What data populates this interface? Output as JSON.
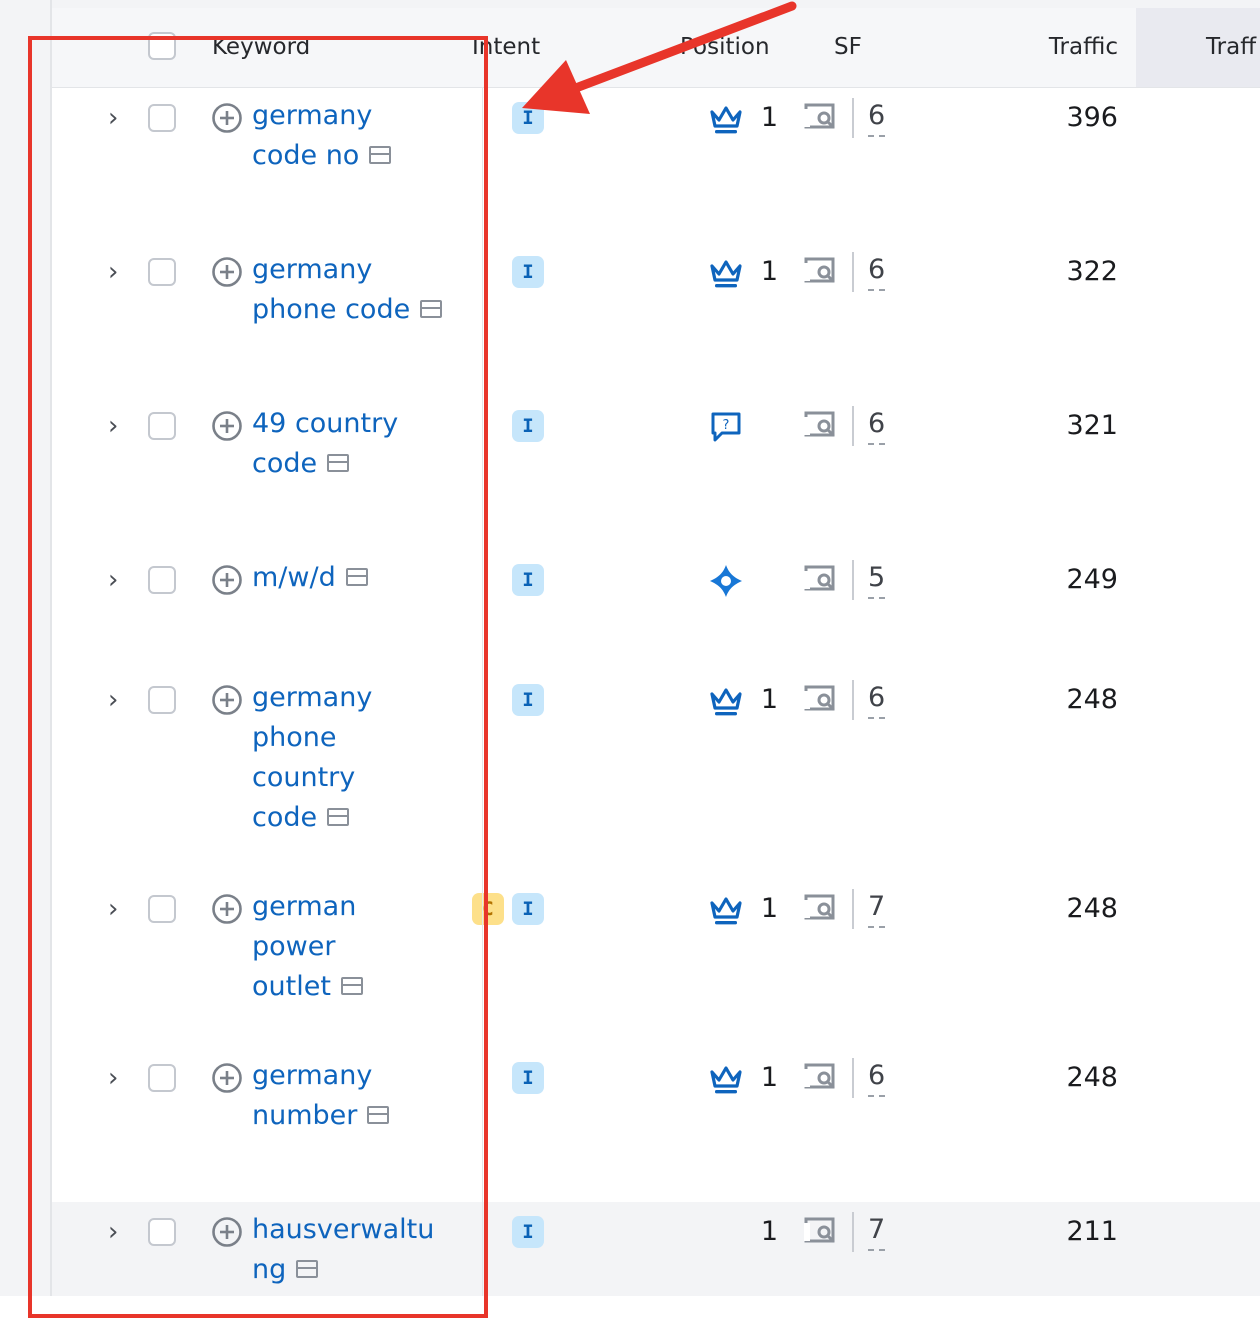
{
  "header": {
    "keyword": "Keyword",
    "intent": "Intent",
    "position": "Position",
    "sf": "SF",
    "traffic": "Traffic",
    "traffic_pct": "Traff"
  },
  "rows": [
    {
      "keyword": "germany code no",
      "intents": [
        "I"
      ],
      "position_icon": "crown-icon",
      "position": "1",
      "sf": "6",
      "traffic": "396"
    },
    {
      "keyword": "germany phone code",
      "intents": [
        "I"
      ],
      "position_icon": "crown-icon",
      "position": "1",
      "sf": "6",
      "traffic": "322"
    },
    {
      "keyword": "49 country code",
      "intents": [
        "I"
      ],
      "position_icon": "question-bubble-icon",
      "position": "",
      "sf": "6",
      "traffic": "321"
    },
    {
      "keyword": "m/w/d",
      "intents": [
        "I"
      ],
      "position_icon": "sparkle-diamond-icon",
      "position": "",
      "sf": "5",
      "traffic": "249"
    },
    {
      "keyword": "germany phone country code",
      "intents": [
        "I"
      ],
      "position_icon": "crown-icon",
      "position": "1",
      "sf": "6",
      "traffic": "248"
    },
    {
      "keyword": "german power outlet",
      "intents": [
        "C",
        "I"
      ],
      "position_icon": "crown-icon",
      "position": "1",
      "sf": "7",
      "traffic": "248"
    },
    {
      "keyword": "germany number",
      "intents": [
        "I"
      ],
      "position_icon": "crown-icon",
      "position": "1",
      "sf": "6",
      "traffic": "248"
    },
    {
      "keyword": "hausverwaltung",
      "intents": [
        "I"
      ],
      "position_icon": "",
      "position": "1",
      "sf": "7",
      "traffic": "211"
    }
  ],
  "colors": {
    "keyword_link": "#0e64bd",
    "intent_informational_bg": "#c6e6fb",
    "intent_commercial_bg": "#fde08a",
    "annotation_red": "#e8352a"
  }
}
